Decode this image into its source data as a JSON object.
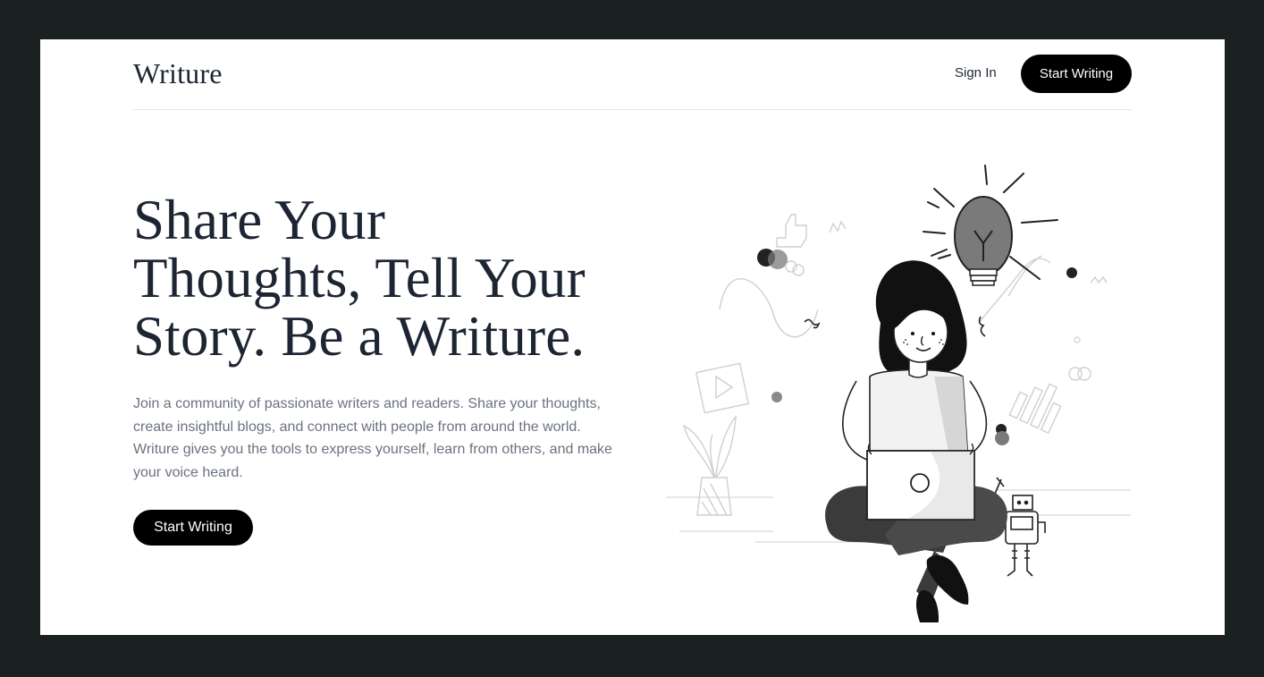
{
  "nav": {
    "logo": "Writure",
    "sign_in": "Sign In",
    "start_writing": "Start Writing"
  },
  "hero": {
    "title_line1": "Share Your",
    "title_line2": "Thoughts, Tell Your",
    "title_line3": "Story. Be a Writure.",
    "description": "Join a community of passionate writers and readers. Share your thoughts, create insightful blogs, and connect with people from around the world. Writure gives you the tools to express yourself, learn from others, and make your voice heard.",
    "cta": "Start Writing"
  },
  "colors": {
    "page_background": "#1b2020",
    "card_background": "#ffffff",
    "primary_button": "#000000",
    "heading_text": "#1d2533",
    "body_text": "#6b7280"
  },
  "illustration": {
    "subject": "woman-with-laptop-illustration",
    "icons": [
      "lightbulb-icon",
      "robot-icon",
      "plant-icon",
      "video-frame-icon",
      "bar-chart-icon",
      "thumbs-up-icon"
    ]
  }
}
